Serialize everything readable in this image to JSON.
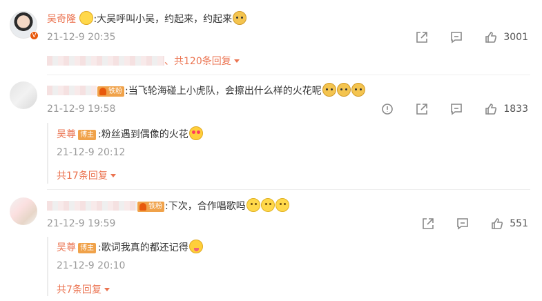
{
  "comments": [
    {
      "author": "吴奇隆",
      "text": ":大吴呼叫小吴，约起来，约起来",
      "time": "21-12-9 20:35",
      "like_count": "3001",
      "replies_summary_suffix": "、共120条回复"
    },
    {
      "badge": "铁粉",
      "text": ":当飞轮海碰上小虎队，会擦出什么样的火花呢",
      "time": "21-12-9 19:58",
      "like_count": "1833",
      "reply": {
        "author": "吴尊",
        "badge": "博主",
        "text": ":粉丝遇到偶像的火花",
        "time": "21-12-9 20:12"
      },
      "more_replies": "共17条回复"
    },
    {
      "badge": "铁粉",
      "text": ":下次，合作唱歌吗",
      "time": "21-12-9 19:59",
      "like_count": "551",
      "reply": {
        "author": "吴尊",
        "badge": "博主",
        "text": ":歌词我真的都还记得",
        "time": "21-12-9 20:10"
      },
      "more_replies": "共7条回复"
    }
  ],
  "icons": {
    "verified": "V",
    "report": "report-icon",
    "share": "share-icon",
    "comment": "comment-icon",
    "like": "thumbs-up-icon"
  },
  "colors": {
    "username": "#eb7350",
    "time": "#999999",
    "badge": "#f0a24a"
  }
}
